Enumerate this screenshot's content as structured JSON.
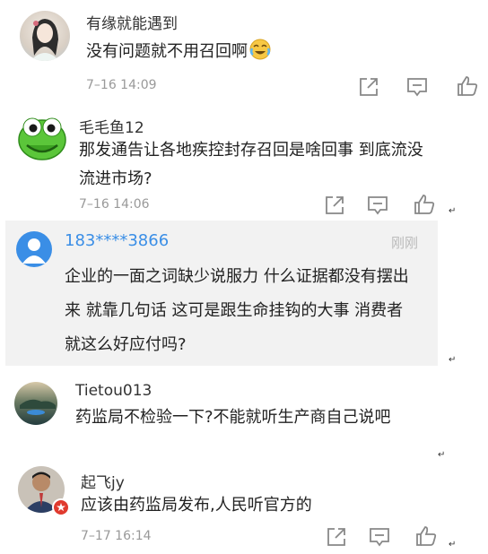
{
  "comments": [
    {
      "username": "有缘就能遇到",
      "text": "没有问题就不用召回啊",
      "emoji": "laughing-crying-emoji",
      "time": "7–16 14:09"
    },
    {
      "username": "毛毛鱼12",
      "text": "那发通告让各地疾控封存召回是啥回事   到底流没流进市场?",
      "time": "7–16 14:06"
    },
    {
      "username": "183****3866",
      "text": "企业的一面之词缺少说服力 什么证据都没有摆出来 就靠几句话 这可是跟生命挂钩的大事 消费者就这么好应付吗?",
      "time": "刚刚"
    },
    {
      "username": "Tietou013",
      "text": "药监局不检验一下?不能就听生产商自己说吧"
    },
    {
      "username": "起飞jy",
      "text": "应该由药监局发布,人民听官方的",
      "time": "7–17 16:14"
    }
  ],
  "colors": {
    "highlight_bg": "#f2f2f2",
    "blue_username": "#3a8ee6",
    "time_gray": "#999999",
    "icon_gray": "#888888"
  },
  "icons": [
    "share-icon",
    "comment-icon",
    "like-icon"
  ]
}
